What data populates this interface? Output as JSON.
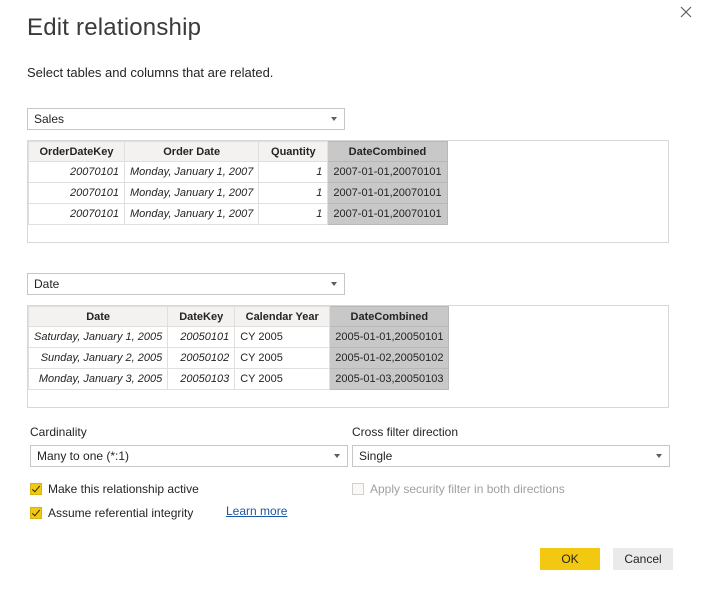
{
  "dialog": {
    "title": "Edit relationship",
    "subtitle": "Select tables and columns that are related."
  },
  "table1": {
    "selected": "Sales",
    "columns": [
      "OrderDateKey",
      "Order Date",
      "Quantity",
      "DateCombined"
    ],
    "rows": [
      [
        "20070101",
        "Monday, January 1, 2007",
        "1",
        "2007-01-01,20070101"
      ],
      [
        "20070101",
        "Monday, January 1, 2007",
        "1",
        "2007-01-01,20070101"
      ],
      [
        "20070101",
        "Monday, January 1, 2007",
        "1",
        "2007-01-01,20070101"
      ]
    ],
    "selected_column": "DateCombined"
  },
  "table2": {
    "selected": "Date",
    "columns": [
      "Date",
      "DateKey",
      "Calendar Year",
      "DateCombined"
    ],
    "rows": [
      [
        "Saturday, January 1, 2005",
        "20050101",
        "CY 2005",
        "2005-01-01,20050101"
      ],
      [
        "Sunday, January 2, 2005",
        "20050102",
        "CY 2005",
        "2005-01-02,20050102"
      ],
      [
        "Monday, January 3, 2005",
        "20050103",
        "CY 2005",
        "2005-01-03,20050103"
      ]
    ],
    "selected_column": "DateCombined"
  },
  "cardinality": {
    "label": "Cardinality",
    "value": "Many to one (*:1)"
  },
  "cross_filter": {
    "label": "Cross filter direction",
    "value": "Single"
  },
  "options": {
    "active": {
      "label": "Make this relationship active",
      "checked": true
    },
    "integrity": {
      "label": "Assume referential integrity",
      "checked": true
    },
    "security": {
      "label": "Apply security filter in both directions",
      "checked": false,
      "disabled": true
    },
    "learn_more": "Learn more"
  },
  "buttons": {
    "ok": "OK",
    "cancel": "Cancel"
  },
  "colors": {
    "accent": "#f2c811",
    "selected_column": "#c8c8c8",
    "link": "#1a56a6"
  }
}
